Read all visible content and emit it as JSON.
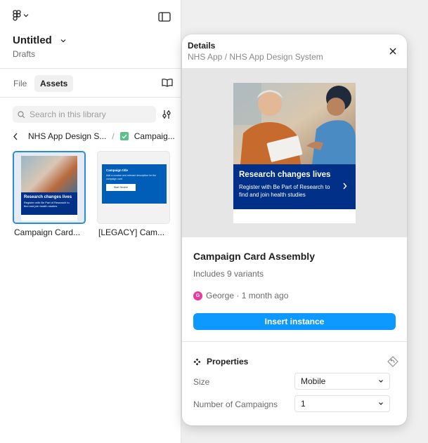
{
  "file": {
    "title": "Untitled",
    "location": "Drafts"
  },
  "tabs": {
    "file": "File",
    "assets": "Assets"
  },
  "search": {
    "placeholder": "Search in this library"
  },
  "breadcrumb": {
    "library": "NHS App Design S...",
    "separator": "/",
    "page": "Campaig..."
  },
  "assets": [
    {
      "label": "Campaign Card...",
      "card_title": "Research changes lives",
      "card_text": "Register with Be Part of Research to find and join health studies"
    },
    {
      "label": "[LEGACY] Cam...",
      "card_title": "Campaign title",
      "card_text": "Add a concise and relevant description for the campaign card",
      "card_button": "Start Service"
    }
  ],
  "details": {
    "title": "Details",
    "path": "NHS App / NHS App Design System",
    "preview_title": "Research changes lives",
    "preview_text": "Register with Be Part of Research to find and join health studies",
    "component_name": "Campaign Card Assembly",
    "variants": "Includes 9 variants",
    "author_initial": "G",
    "author": "George · 1 month ago",
    "insert_label": "Insert instance",
    "properties_label": "Properties",
    "properties": [
      {
        "label": "Size",
        "value": "Mobile"
      },
      {
        "label": "Number of Campaigns",
        "value": "1"
      }
    ]
  },
  "colors": {
    "accent": "#0d99ff",
    "nhs_dark_blue": "#003087",
    "nhs_blue": "#005eb8",
    "avatar": "#ea3aa1",
    "selected_border": "#2a8cd6"
  }
}
